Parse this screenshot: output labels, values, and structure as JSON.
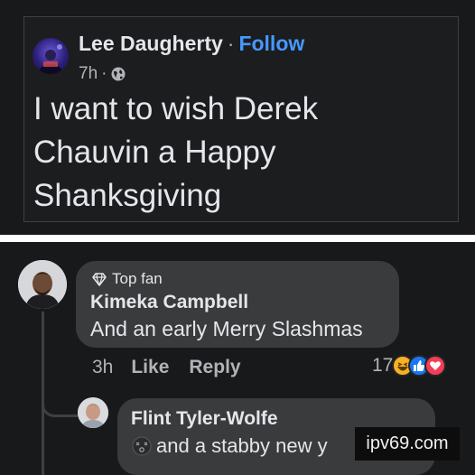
{
  "post": {
    "author": "Lee Daugherty",
    "separator": "·",
    "follow_label": "Follow",
    "time": "7h",
    "meta_separator": "·",
    "privacy_icon": "globe-icon",
    "text": "I want to wish Derek Chauvin a Happy Shanksgiving"
  },
  "comments": [
    {
      "badge_icon": "diamond-icon",
      "badge": "Top fan",
      "author": "Kimeka Campbell",
      "text": "And an early Merry Slashmas",
      "time": "3h",
      "like_label": "Like",
      "reply_label": "Reply",
      "reaction_count": "17",
      "reactions": [
        "haha-reaction-icon",
        "like-reaction-icon",
        "love-reaction-icon"
      ]
    },
    {
      "author": "Flint Tyler-Wolfe",
      "emoji_icon": "dizzy-face-icon",
      "text": "and a stabby new y"
    }
  ],
  "watermark": "ipv69.com",
  "colors": {
    "background": "#18191a",
    "bubble": "#3a3b3c",
    "text_primary": "#e4e6eb",
    "text_secondary": "#b0b3b8",
    "follow": "#4599ff",
    "like_blue": "#1877f2",
    "love_red": "#f33e58",
    "haha_yellow": "#f7b125"
  }
}
